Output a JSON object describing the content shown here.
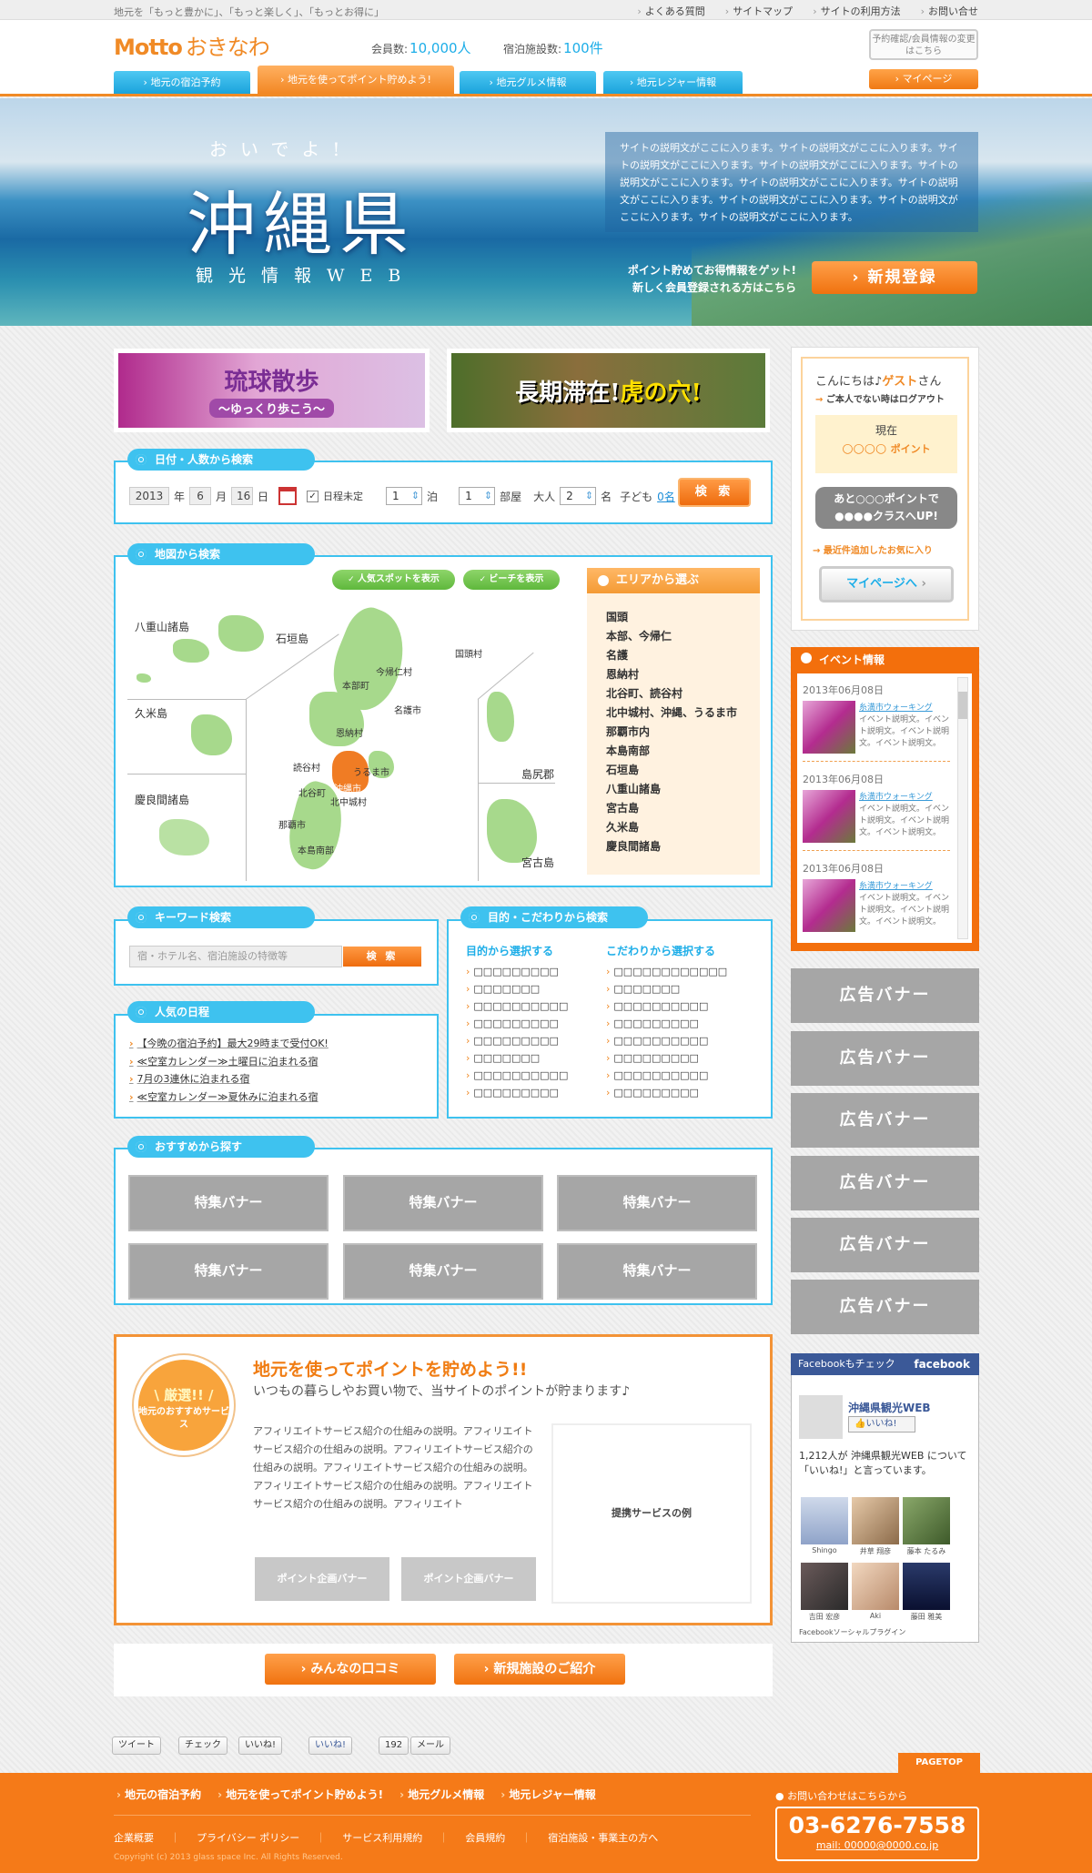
{
  "topbar": {
    "tagline": "地元を「もっと豊かに」、「もっと楽しく」、「もっとお得に」",
    "links": [
      "よくある質問",
      "サイトマップ",
      "サイトの利用方法",
      "お問い合せ"
    ]
  },
  "header": {
    "logo_en": "Motto",
    "logo_jp": "おきなわ",
    "members_label": "会員数:",
    "members_value": "10,000人",
    "facilities_label": "宿泊施設数:",
    "facilities_value": "100件",
    "account_btn": "予約確認/会員情報の変更はこちら",
    "mypage_btn": "マイページ"
  },
  "tabs": [
    "地元の宿泊予約",
    "地元を使ってポイント貯めよう!",
    "地元グルメ情報",
    "地元レジャー情報"
  ],
  "hero": {
    "sub": "おいでよ!",
    "title": "沖縄県",
    "kanji": "観光情報WEB",
    "desc": "サイトの説明文がここに入ります。サイトの説明文がここに入ります。サイトの説明文がここに入ります。サイトの説明文がここに入ります。サイトの説明文がここに入ります。サイトの説明文がここに入ります。サイトの説明文がここに入ります。サイトの説明文がここに入ります。サイトの説明文がここに入ります。サイトの説明文がここに入ります。",
    "reg_line1": "ポイント貯めてお得情報をゲット!",
    "reg_line2": "新しく会員登録される方はこちら",
    "register_btn": "新規登録"
  },
  "promos": {
    "p1_title": "琉球散歩",
    "p1_sub": "〜ゆっくり歩こう〜",
    "p2_a": "長期滞在!",
    "p2_b": "虎の穴!"
  },
  "date_search": {
    "title": "日付・人数から検索",
    "year": "2013",
    "year_l": "年",
    "month": "6",
    "month_l": "月",
    "day": "16",
    "day_l": "日",
    "undecided": "日程未定",
    "nights": "1",
    "nights_l": "泊",
    "rooms": "1",
    "rooms_l": "部屋",
    "adult_l": "大人",
    "adults": "2",
    "adults_u": "名",
    "child_l": "子ども",
    "child_v": "0名",
    "btn": "検 索"
  },
  "map_search": {
    "title": "地図から検索",
    "pill1": "人気スポットを表示",
    "pill2": "ビーチを表示",
    "labels": {
      "yaeyama": "八重山諸島",
      "ishigaki": "石垣島",
      "kume": "久米島",
      "kerama": "慶良間諸島",
      "kunigami": "国頭村",
      "nakijin": "今帰仁村",
      "motobu": "本部町",
      "nago": "名護市",
      "onna": "恩納村",
      "yomitan": "読谷村",
      "uruma": "うるま市",
      "chatan": "北谷町",
      "okinawa": "沖縄市",
      "kitanaka": "北中城村",
      "naha": "那覇市",
      "south": "本島南部",
      "ishijiri": "島尻郡",
      "miyako": "宮古島"
    },
    "area_title": "エリアから選ぶ",
    "areas": [
      "国頭",
      "本部、今帰仁",
      "名護",
      "恩納村",
      "北谷町、読谷村",
      "北中城村、沖縄、うるま市",
      "那覇市内",
      "本島南部",
      "石垣島",
      "八重山諸島",
      "宮古島",
      "久米島",
      "慶良間諸島"
    ]
  },
  "keyword": {
    "title": "キーワード検索",
    "placeholder": "宿・ホテル名、宿泊施設の特徴等",
    "btn": "検 索"
  },
  "purpose": {
    "title": "目的・こだわりから検索",
    "col1": "目的から選択する",
    "col2": "こだわりから選択する",
    "items1": [
      "□□□□□□□□□",
      "□□□□□□□",
      "□□□□□□□□□□",
      "□□□□□□□□□",
      "□□□□□□□□□",
      "□□□□□□□",
      "□□□□□□□□□□",
      "□□□□□□□□□"
    ],
    "items2": [
      "□□□□□□□□□□□□",
      "□□□□□□□",
      "□□□□□□□□□□",
      "□□□□□□□□□",
      "□□□□□□□□□□",
      "□□□□□□□□□",
      "□□□□□□□□□□",
      "□□□□□□□□□"
    ]
  },
  "popular": {
    "title": "人気の日程",
    "items": [
      "【今晩の宿泊予約】最大29時まで受付OK!",
      "≪空室カレンダー≫土曜日に泊まれる宿",
      "7月の3連休に泊まれる宿",
      "≪空室カレンダー≫夏休みに泊まれる宿"
    ]
  },
  "recommend": {
    "title": "おすすめから探す",
    "banner": "特集バナー"
  },
  "affiliate": {
    "badge_a": "\\ 厳選!! /",
    "badge_b": "地元のおすすめサービス",
    "title": "地元を使ってポイントを貯めよう!!",
    "sub": "いつもの暮らしやお買い物で、当サイトのポイントが貯まります♪",
    "text": "アフィリエイトサービス紹介の仕組みの説明。アフィリエイトサービス紹介の仕組みの説明。アフィリエイトサービス紹介の仕組みの説明。アフィリエイトサービス紹介の仕組みの説明。アフィリエイトサービス紹介の仕組みの説明。アフィリエイトサービス紹介の仕組みの説明。アフィリエイト",
    "pbanner": "ポイント企画バナー",
    "example": "提携サービスの例"
  },
  "bottom_btns": [
    "みんなの口コミ",
    "新規施設のご紹介"
  ],
  "social": {
    "tweet": "ツイート",
    "check": "チェック",
    "iine": "いいね!",
    "fb_like": "いいね!",
    "count": "192",
    "mail": "メール"
  },
  "sidebar": {
    "hello": "こんにちは♪",
    "guest": "ゲスト",
    "san": "さん",
    "logout": "ご本人でない時はログアウト",
    "now": "現在",
    "points": "○○○○",
    "points_u": "ポイント",
    "up1": "あと○○○ポイントで",
    "up2": "●●●●クラスへUP!",
    "recent": "最近件追加したお気に入り",
    "mypage": "マイページへ"
  },
  "events": {
    "title": "イベント情報",
    "items": [
      {
        "date": "2013年06月08日",
        "title": "糸満市ウォーキング",
        "text": "イベント説明文。イベント説明文。イベント説明文。イベント説明文。"
      },
      {
        "date": "2013年06月08日",
        "title": "糸満市ウォーキング",
        "text": "イベント説明文。イベント説明文。イベント説明文。イベント説明文。"
      },
      {
        "date": "2013年06月08日",
        "title": "糸満市ウォーキング",
        "text": "イベント説明文。イベント説明文。イベント説明文。イベント説明文。"
      }
    ]
  },
  "ads": "広告バナー",
  "facebook": {
    "check": "Facebookもチェック",
    "brand": "facebook",
    "page": "沖縄県観光WEB",
    "like": "👍いいね!",
    "count": "1,212人が 沖縄県観光WEB について「いいね!」と言っています。",
    "people": [
      "Shingo",
      "井草 翔彦",
      "藤本 たるみ",
      "吉田 宏彦",
      "Aki",
      "藤田 雅美"
    ],
    "footer": "Facebookソーシャルプラグイン"
  },
  "footer": {
    "pagetop": "PAGETOP",
    "nav": [
      "地元の宿泊予約",
      "地元を使ってポイント貯めよう!",
      "地元グルメ情報",
      "地元レジャー情報"
    ],
    "links": [
      "企業概要",
      "プライバシー ポリシー",
      "サービス利用規約",
      "会員規約",
      "宿泊施設・事業主の方へ"
    ],
    "copyright": "Copyright (c) 2013 glass space Inc. All Rights Reserved.",
    "contact_label": "お問い合わせはこちらから",
    "tel": "03-6276-7558",
    "mail": "mail: 00000@0000.co.jp"
  }
}
